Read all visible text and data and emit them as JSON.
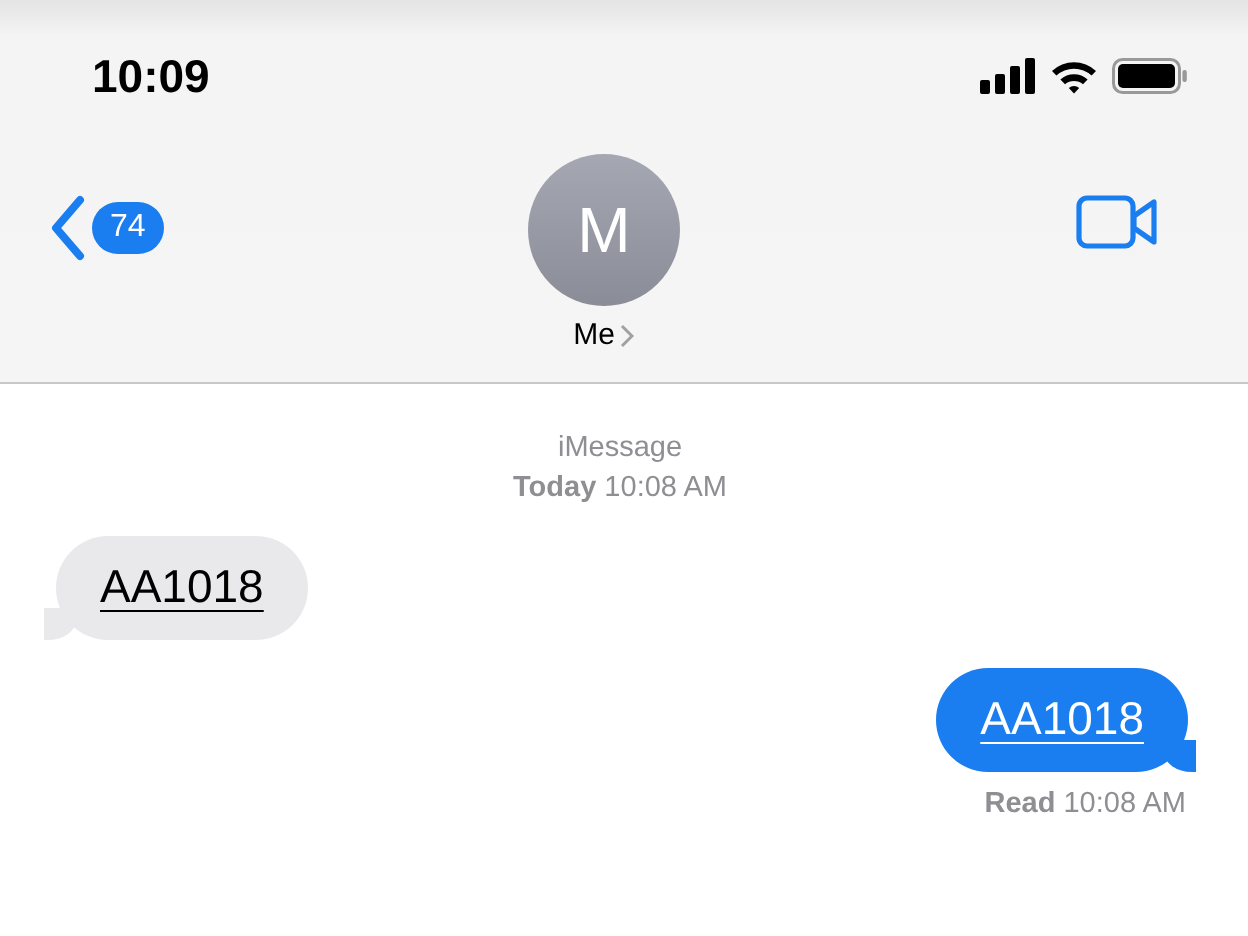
{
  "status_bar": {
    "time": "10:09"
  },
  "header": {
    "back_count": "74",
    "avatar_initial": "M",
    "contact_name": "Me"
  },
  "conversation": {
    "service": "iMessage",
    "timestamp": "**Today** 10:08 AM",
    "messages": [
      {
        "kind": "received",
        "text": "AA1018"
      },
      {
        "kind": "sent",
        "text": "AA1018"
      }
    ],
    "receipt": "**Read** 10:08 AM"
  }
}
